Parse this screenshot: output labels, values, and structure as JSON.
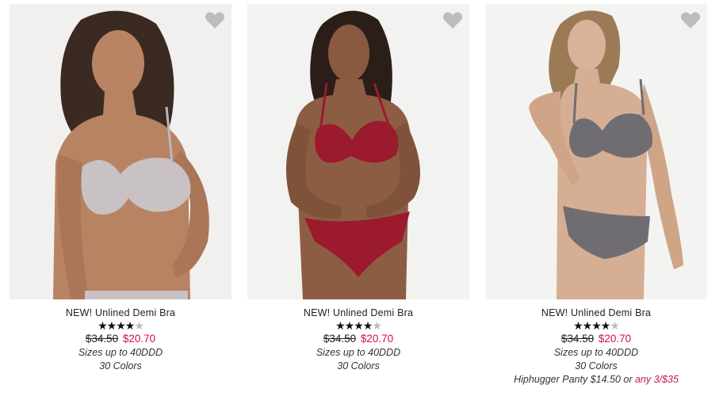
{
  "products": [
    {
      "title": "NEW! Unlined Demi Bra",
      "rating": 4.5,
      "stars_full": "★★★★",
      "stars_half": "★",
      "price_original": "$34.50",
      "price_sale": "$20.70",
      "sizes": "Sizes up to 40DDD",
      "colors": "30 Colors",
      "bra_color": "#c9c2c4",
      "bg_color": "#f1f0ee"
    },
    {
      "title": "NEW! Unlined Demi Bra",
      "rating": 4.5,
      "stars_full": "★★★★",
      "stars_half": "★",
      "price_original": "$34.50",
      "price_sale": "$20.70",
      "sizes": "Sizes up to 40DDD",
      "colors": "30 Colors",
      "bra_color": "#9b1a2e",
      "bg_color": "#f2f2f0"
    },
    {
      "title": "NEW! Unlined Demi Bra",
      "rating": 4.5,
      "stars_full": "★★★★",
      "stars_half": "★",
      "price_original": "$34.50",
      "price_sale": "$20.70",
      "sizes": "Sizes up to 40DDD",
      "colors": "30 Colors",
      "promo_text": "Hiphugger Panty $14.50 or ",
      "promo_deal": "any 3/$35",
      "bra_color": "#6f6d72",
      "bg_color": "#f3f3f2"
    }
  ],
  "icons": {
    "wishlist": "heart-icon"
  },
  "colors": {
    "sale": "#d0114a",
    "promo": "#c2185b",
    "heart": "#bcbcbc"
  }
}
